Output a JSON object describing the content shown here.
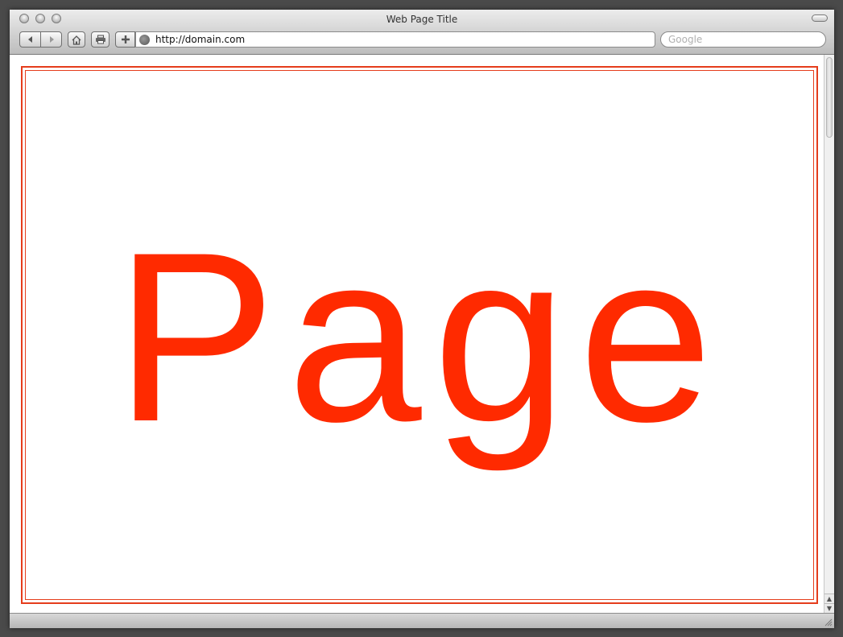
{
  "window": {
    "title": "Web Page Title"
  },
  "toolbar": {
    "address": {
      "value": "http://domain.com"
    },
    "search": {
      "placeholder": "Google"
    }
  },
  "page": {
    "headline": "Page",
    "accent_color": "#ff2a00"
  },
  "icons": {
    "back": "back-arrow-icon",
    "forward": "forward-arrow-icon",
    "home": "home-icon",
    "print": "print-icon",
    "add_bookmark": "plus-icon",
    "site": "globe-icon"
  }
}
